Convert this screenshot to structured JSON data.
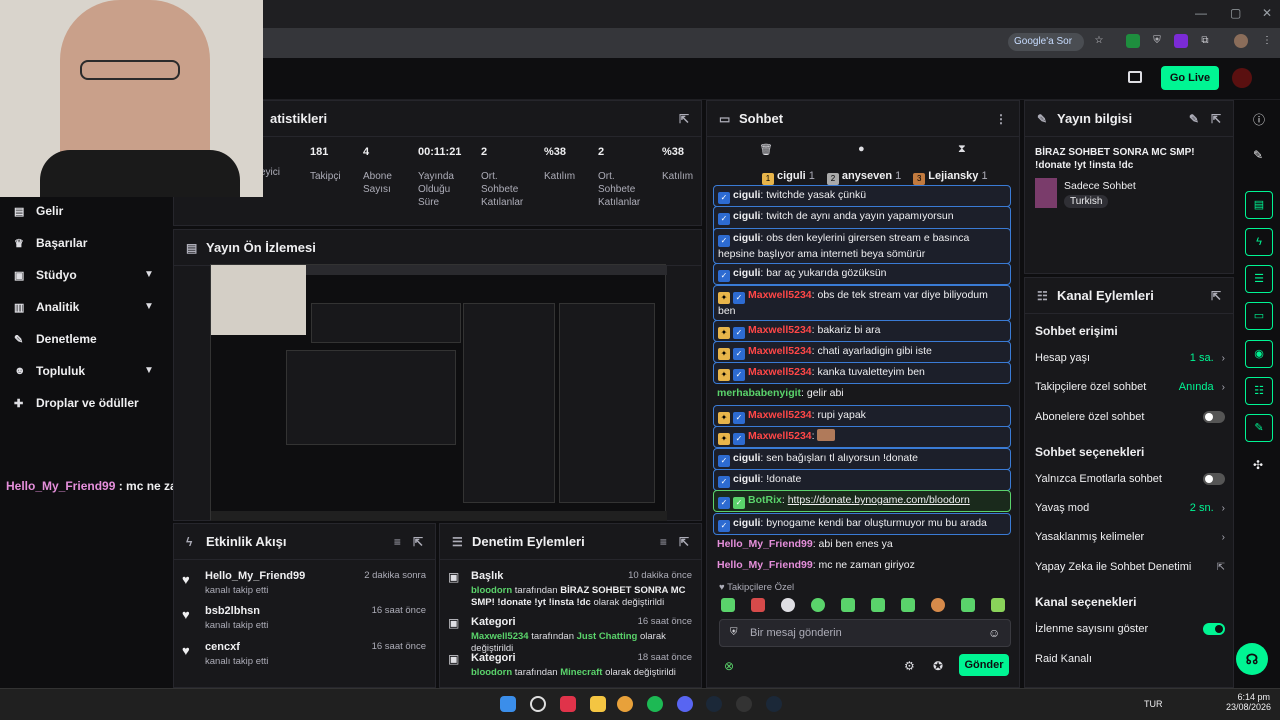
{
  "browser": {
    "google_pill": "Google'a Sor",
    "window_controls": [
      "—",
      "▢",
      "✕"
    ]
  },
  "topbar": {
    "go_live": "Go Live"
  },
  "stats": {
    "title": "atistikleri",
    "cells": [
      {
        "value": "",
        "label": "eyici"
      },
      {
        "value": "181",
        "label": "Takipçi"
      },
      {
        "value": "4",
        "label": "Abone Sayısı"
      },
      {
        "value": "00:11:21",
        "label": "Yayında Olduğu Süre"
      },
      {
        "value": "2",
        "label": "Ort. Sohbete Katılanlar"
      },
      {
        "value": "%38",
        "label": "Katılım"
      },
      {
        "value": "2",
        "label": "Ort. Sohbete Katılanlar"
      },
      {
        "value": "%38",
        "label": "Katılım"
      }
    ]
  },
  "sidebar": {
    "items": [
      {
        "label": "Gelir",
        "icon": "income-icon"
      },
      {
        "label": "Başarılar",
        "icon": "trophy-icon"
      },
      {
        "label": "Stüdyo",
        "icon": "studio-icon",
        "chevron": true
      },
      {
        "label": "Analitik",
        "icon": "analytics-icon",
        "chevron": true
      },
      {
        "label": "Denetleme",
        "icon": "wrench-icon"
      },
      {
        "label": "Topluluk",
        "icon": "community-icon",
        "chevron": true
      },
      {
        "label": "Droplar ve ödüller",
        "icon": "gift-icon"
      }
    ]
  },
  "overlay_chat": {
    "user": "Hello_My_Friend99",
    "text": " : mc ne zaman giriyoz"
  },
  "preview": {
    "title": "Yayın Ön İzlemesi"
  },
  "activity": {
    "title": "Etkinlik Akışı",
    "items": [
      {
        "name": "Hello_My_Friend99",
        "sub": "kanalı takip etti",
        "time": "2 dakika sonra"
      },
      {
        "name": "bsb2lbhsn",
        "sub": "kanalı takip etti",
        "time": "16 saat önce"
      },
      {
        "name": "cencxf",
        "sub": "kanalı takip etti",
        "time": "16 saat önce"
      }
    ]
  },
  "mod_actions": {
    "title": "Denetim Eylemleri",
    "items": [
      {
        "head": "Başlık",
        "user": "bloodorn",
        "mid": " tarafından ",
        "value": "BİRAZ SOHBET SONRA MC SMP! !donate !yt !insta !dc",
        "tail": " olarak değiştirildi",
        "time": "10 dakika önce"
      },
      {
        "head": "Kategori",
        "user": "Maxwell5234",
        "mid": " tarafından ",
        "value": "Just Chatting",
        "tail": " olarak değiştirildi",
        "time": "16 saat önce"
      },
      {
        "head": "Kategori",
        "user": "bloodorn",
        "mid": " tarafından ",
        "value": "Minecraft",
        "tail": " olarak değiştirildi",
        "time": "18 saat önce"
      }
    ]
  },
  "chat": {
    "title": "Sohbet",
    "leaders": [
      {
        "rank": "1",
        "name": "ciguli",
        "count": "1"
      },
      {
        "rank": "2",
        "name": "anyseven",
        "count": "1"
      },
      {
        "rank": "3",
        "name": "Lejiansky",
        "count": "1"
      }
    ],
    "messages": [
      {
        "user": "ciguli",
        "text": ": twitchde yasak çünkü"
      },
      {
        "user": "ciguli",
        "text": ": twitch de aynı anda yayın yapamıyorsun partnersen"
      },
      {
        "user": "ciguli",
        "text": ": obs den keylerini girersen stream e basınca hepsine başlıyor ama interneti beya sömürür"
      },
      {
        "user": "ciguli",
        "text": ": bar aç yukarıda gözüksün"
      },
      {
        "user": "Maxwell5234",
        "text": ": obs de tek stream var diye biliyodum ben"
      },
      {
        "user": "Maxwell5234",
        "text": ": bakariz bi ara"
      },
      {
        "user": "Maxwell5234",
        "text": ": chati ayarladigin gibi iste"
      },
      {
        "user": "Maxwell5234",
        "text": ": kanka tuvaletteyim ben"
      },
      {
        "user": "merhababenyigit",
        "text": ": gelir abi"
      },
      {
        "user": "Maxwell5234",
        "text": ": rupi yapak"
      },
      {
        "user": "Maxwell5234",
        "text": ":"
      },
      {
        "user": "ciguli",
        "text": ": sen bağışları tl alıyorsun !donate"
      },
      {
        "user": "ciguli",
        "text": ": !donate"
      },
      {
        "user": "BotRix",
        "text": ": ",
        "link": "https://donate.bynogame.com/bloodorn"
      },
      {
        "user": "ciguli",
        "text": ": bynogame kendi bar oluşturmuyor mu bu arada"
      },
      {
        "user": "Hello_My_Friend99",
        "text": ": abi ben enes ya"
      },
      {
        "user": "Hello_My_Friend99",
        "text": ": mc ne zaman giriyoz"
      }
    ],
    "followers_only": "Takipçilere Özel",
    "input_placeholder": "Bir mesaj gönderin",
    "send": "Gönder"
  },
  "stream_info": {
    "title": "Yayın bilgisi",
    "stream_title": "BİRAZ SOHBET SONRA MC SMP! !donate !yt !insta !dc",
    "category": "Sadece Sohbet",
    "tag": "Turkish"
  },
  "channel_actions": {
    "title": "Kanal Eylemleri",
    "chat_access": "Sohbet erişimi",
    "account_age": {
      "label": "Hesap yaşı",
      "value": "1 sa."
    },
    "followers_chat": {
      "label": "Takipçilere özel sohbet",
      "value": "Anında"
    },
    "subs_chat": {
      "label": "Abonelere özel sohbet"
    },
    "chat_options": "Sohbet seçenekleri",
    "emote_only": {
      "label": "Yalnızca Emotlarla sohbet"
    },
    "slow_mode": {
      "label": "Yavaş mod",
      "value": "2 sn."
    },
    "banned_words": {
      "label": "Yasaklanmış kelimeler"
    },
    "ai_mod": {
      "label": "Yapay Zeka ile Sohbet Denetimi"
    },
    "channel_options": "Kanal seçenekleri",
    "show_viewers": {
      "label": "İzlenme sayısını göster"
    },
    "raid": {
      "label": "Raid Kanalı"
    }
  },
  "taskbar": {
    "lang": "TUR",
    "time": "6:14 pm",
    "date": "23/08/2026"
  }
}
